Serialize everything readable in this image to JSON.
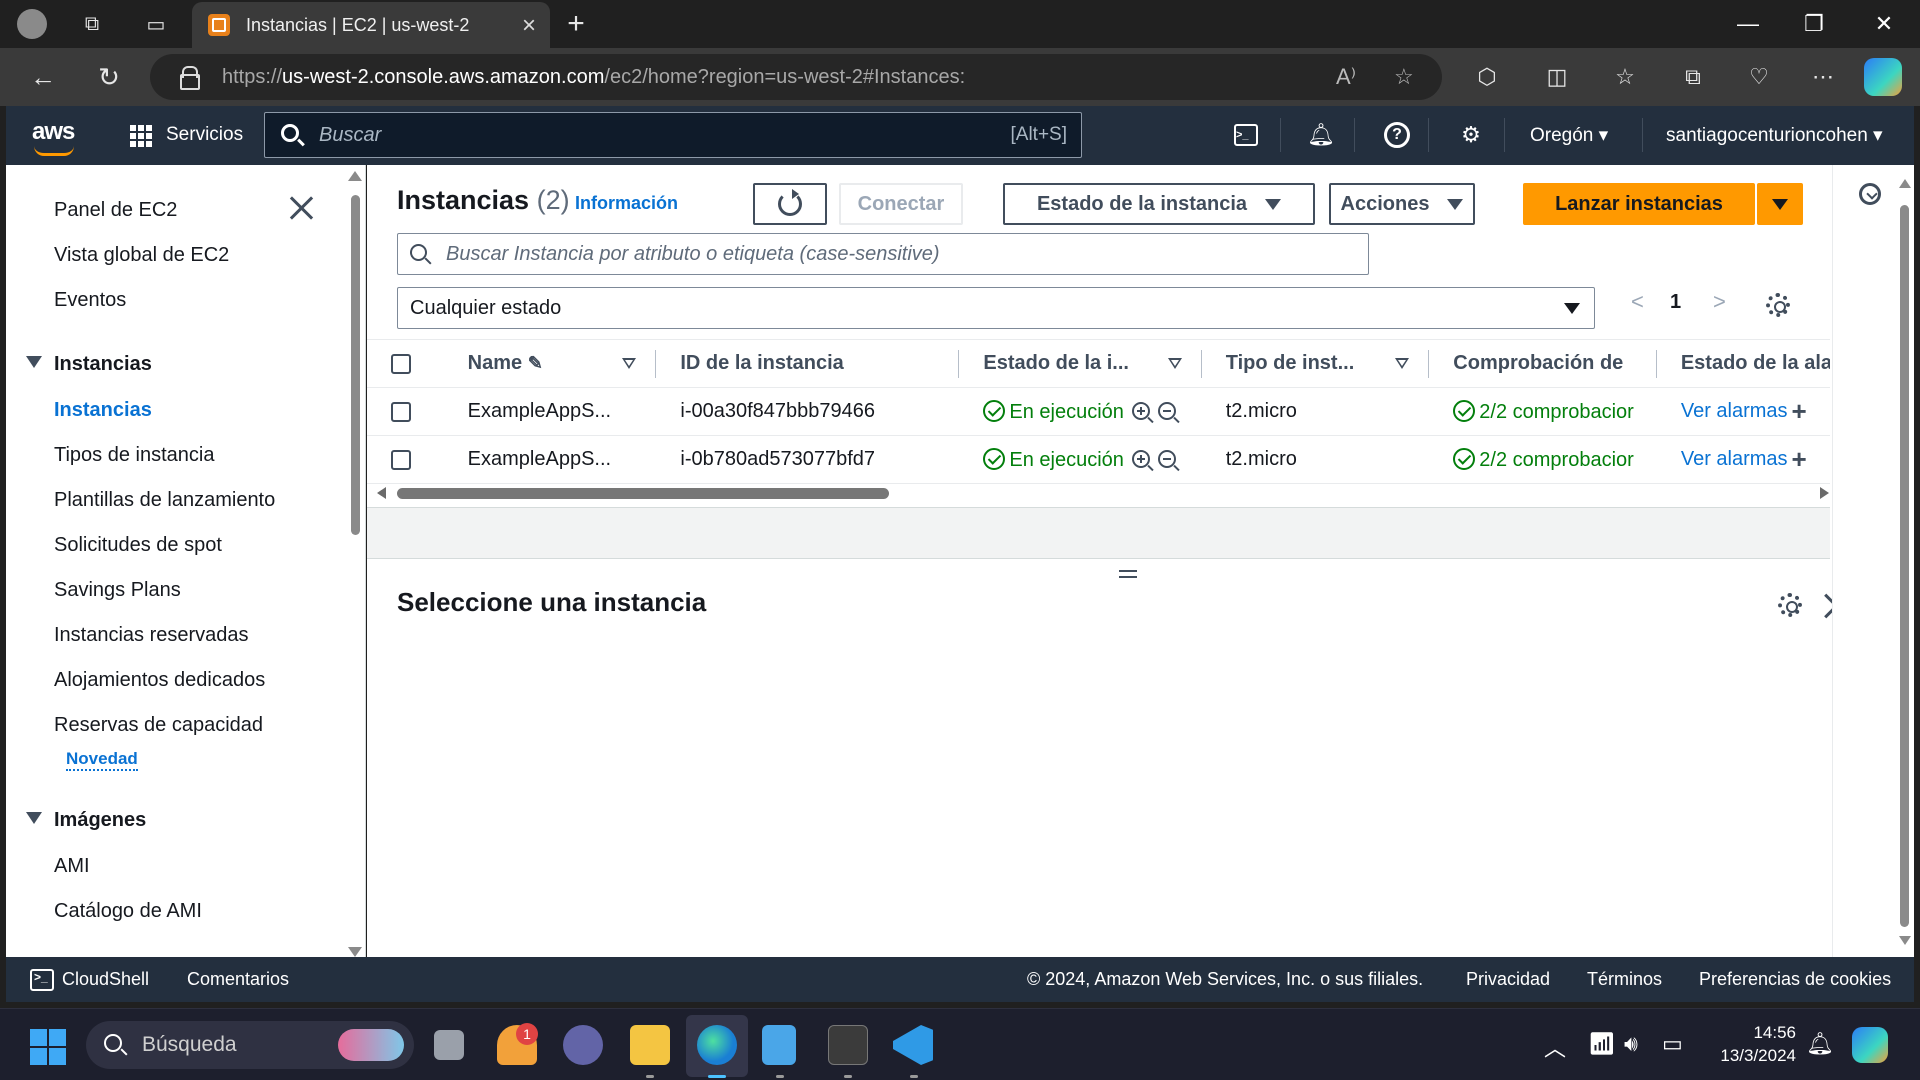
{
  "browser": {
    "tab_title": "Instancias | EC2 | us-west-2",
    "url_prefix": "https://",
    "url_host": "us-west-2.console.aws.amazon.com",
    "url_path": "/ec2/home?region=us-west-2#Instances:"
  },
  "aws_header": {
    "logo": "aws",
    "services_label": "Servicios",
    "search_placeholder": "Buscar",
    "search_shortcut": "[Alt+S]",
    "region": "Oregón",
    "user": "santiagocenturioncohen"
  },
  "sidebar": {
    "top_items": [
      "Panel de EC2",
      "Vista global de EC2",
      "Eventos"
    ],
    "section_instances": "Instancias",
    "instance_items": [
      "Instancias",
      "Tipos de instancia",
      "Plantillas de lanzamiento",
      "Solicitudes de spot",
      "Savings Plans",
      "Instancias reservadas",
      "Alojamientos dedicados",
      "Reservas de capacidad"
    ],
    "new_badge": "Novedad",
    "section_images": "Imágenes",
    "image_items": [
      "AMI",
      "Catálogo de AMI"
    ]
  },
  "main": {
    "title": "Instancias",
    "count": "(2)",
    "info": "Información",
    "connect": "Conectar",
    "instance_state": "Estado de la instancia",
    "actions": "Acciones",
    "launch": "Lanzar instancias",
    "filter_placeholder": "Buscar Instancia por atributo o etiqueta (case-sensitive)",
    "state_filter": "Cualquier estado",
    "page": "1",
    "columns": [
      "Name",
      "ID de la instancia",
      "Estado de la i...",
      "Tipo de inst...",
      "Comprobación de",
      "Estado de la ala"
    ],
    "rows": [
      {
        "name": "ExampleAppS...",
        "id": "i-00a30f847bbb79466",
        "state": "En ejecución",
        "type": "t2.micro",
        "check": "2/2 comprobacior",
        "alarm": "Ver alarmas"
      },
      {
        "name": "ExampleAppS...",
        "id": "i-0b780ad573077bfd7",
        "state": "En ejecución",
        "type": "t2.micro",
        "check": "2/2 comprobacior",
        "alarm": "Ver alarmas"
      }
    ],
    "detail_title": "Seleccione una instancia"
  },
  "footer": {
    "cloudshell": "CloudShell",
    "feedback": "Comentarios",
    "copyright": "© 2024, Amazon Web Services, Inc. o sus filiales.",
    "privacy": "Privacidad",
    "terms": "Términos",
    "cookies": "Preferencias de cookies"
  },
  "taskbar": {
    "search": "Búsqueda",
    "notification_count": "1",
    "time": "14:56",
    "date": "13/3/2024"
  },
  "colors": {
    "aws_nav": "#232f3e",
    "link": "#0972d3",
    "success": "#037f0c",
    "primary_button": "#ff9900"
  }
}
